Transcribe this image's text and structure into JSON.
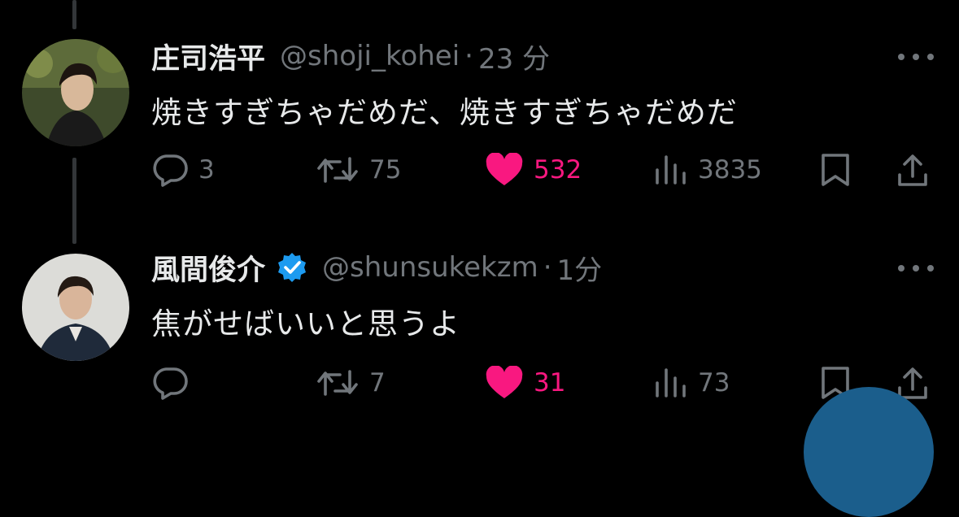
{
  "colors": {
    "background": "#000000",
    "text": "#e7e9ea",
    "muted": "#71767b",
    "like": "#f91880",
    "verified": "#1d9bf0",
    "fab": "#1b5e8c"
  },
  "tweets": [
    {
      "display_name": "庄司浩平",
      "handle": "@shoji_kohei",
      "separator": "·",
      "time": "23 分",
      "verified": false,
      "text": "焼きすぎちゃだめだ、焼きすぎちゃだめだ",
      "actions": {
        "replies": "3",
        "retweets": "75",
        "likes": "532",
        "views": "3835"
      }
    },
    {
      "display_name": "風間俊介",
      "handle": "@shunsukekzm",
      "separator": "·",
      "time": "1分",
      "verified": true,
      "text": "焦がせばいいと思うよ",
      "actions": {
        "replies": "",
        "retweets": "7",
        "likes": "31",
        "views": "73"
      }
    }
  ],
  "icons": {
    "reply": "reply-icon",
    "retweet": "retweet-icon",
    "like": "heart-filled-icon",
    "views": "views-bar-chart-icon",
    "bookmark": "bookmark-icon",
    "share": "share-icon",
    "more": "more-dots-icon",
    "verified": "verified-badge-icon"
  }
}
